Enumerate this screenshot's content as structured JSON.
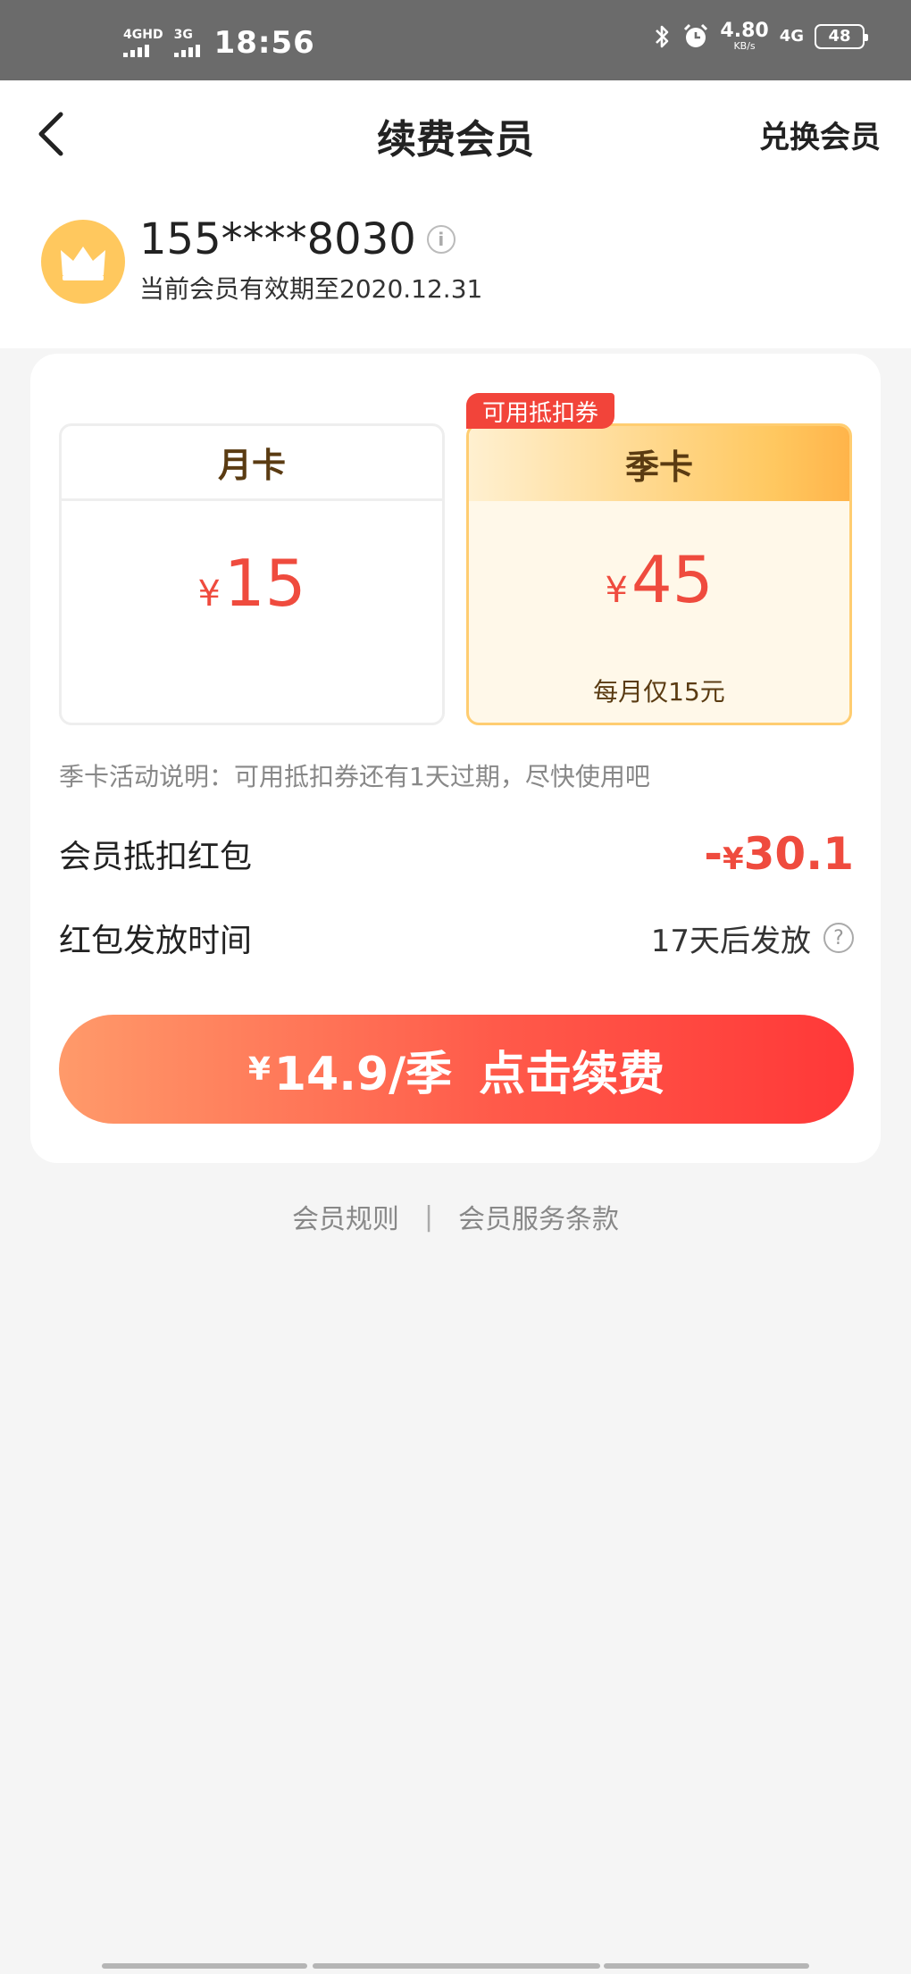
{
  "status_bar": {
    "net1": "4GHD",
    "net2": "3G",
    "time": "18:56",
    "speed_value": "4.80",
    "speed_unit": "KB/s",
    "network": "4G",
    "battery": "48"
  },
  "nav": {
    "title": "续费会员",
    "action": "兑换会员"
  },
  "user": {
    "phone": "155****8030",
    "expiry": "当前会员有效期至2020.12.31"
  },
  "plans": [
    {
      "name": "月卡",
      "currency": "¥",
      "price": "15",
      "note": ""
    },
    {
      "name": "季卡",
      "currency": "¥",
      "price": "45",
      "note": "每月仅15元",
      "tag": "可用抵扣券"
    }
  ],
  "activity_note": "季卡活动说明：可用抵扣券还有1天过期，尽快使用吧",
  "deduction": {
    "label": "会员抵扣红包",
    "prefix": "-",
    "currency": "¥",
    "amount": "30.1"
  },
  "release": {
    "label": "红包发放时间",
    "value": "17天后发放"
  },
  "renew_button": {
    "currency": "¥",
    "price": "14.9/季",
    "action": "点击续费"
  },
  "footer": {
    "rules": "会员规则",
    "separator": "|",
    "terms": "会员服务条款"
  },
  "colors": {
    "accent_red": "#ef4b3e",
    "gold": "#ffcd71",
    "status_bar_bg": "#6b6b6b"
  }
}
